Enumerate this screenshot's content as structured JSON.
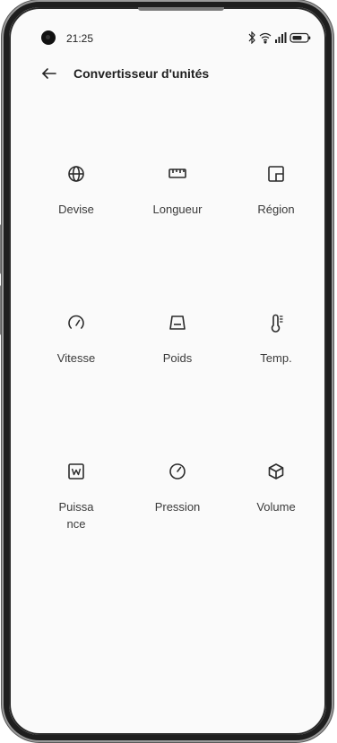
{
  "status_bar": {
    "time": "21:25",
    "icons": [
      "bluetooth-icon",
      "wifi-icon",
      "signal-icon",
      "battery-icon"
    ]
  },
  "header": {
    "back_icon": "back-arrow-icon",
    "title": "Convertisseur d'unités"
  },
  "categories": [
    {
      "label": "Devise",
      "icon": "globe-icon"
    },
    {
      "label": "Longueur",
      "icon": "ruler-icon"
    },
    {
      "label": "Région",
      "icon": "area-icon"
    },
    {
      "label": "Vitesse",
      "icon": "speedometer-icon"
    },
    {
      "label": "Poids",
      "icon": "weight-icon"
    },
    {
      "label": "Temp.",
      "icon": "thermometer-icon"
    },
    {
      "label": "Puissance",
      "icon": "power-watt-icon"
    },
    {
      "label": "Pression",
      "icon": "gauge-icon"
    },
    {
      "label": "Volume",
      "icon": "cube-icon"
    }
  ],
  "colors": {
    "background": "#fafafa",
    "text": "#1f1f1f",
    "icon": "#2b2b2b",
    "frame": "#1e1e1e"
  }
}
